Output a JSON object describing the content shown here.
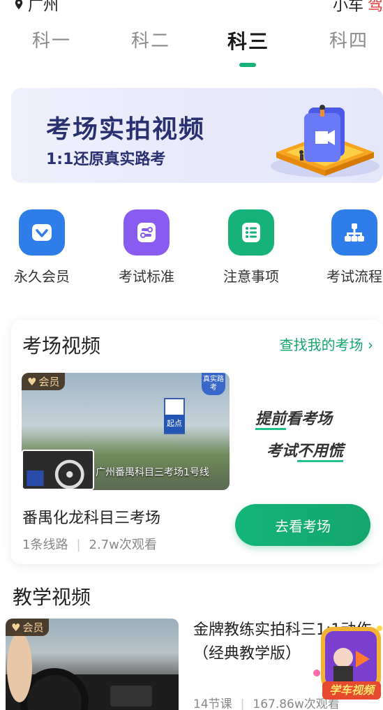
{
  "top": {
    "location": "广州",
    "right_text": "小车",
    "right_red": "驾"
  },
  "tabs": [
    {
      "label": "科一",
      "active": false
    },
    {
      "label": "科二",
      "active": false
    },
    {
      "label": "科三",
      "active": true
    },
    {
      "label": "科四",
      "active": false
    }
  ],
  "banner": {
    "title": "考场实拍视频",
    "subtitle": "1:1还原真实路考"
  },
  "quick_actions": [
    {
      "label": "永久会员",
      "icon": "diamond-icon",
      "color": "#2f7de8"
    },
    {
      "label": "考试标准",
      "icon": "list-toggle-icon",
      "color": "#8a5bf0"
    },
    {
      "label": "注意事项",
      "icon": "checklist-icon",
      "color": "#16b27a"
    },
    {
      "label": "考试流程",
      "icon": "flowchart-icon",
      "color": "#2f7de8"
    }
  ],
  "exam_video": {
    "title": "考场视频",
    "link": "查找我的考场",
    "vip_badge": "会员",
    "real_tag": "真实路考",
    "route_caption": "广州番禺科目三考场1号线",
    "sign_text": "起点",
    "slogan_1": "提前看考场",
    "slogan_2": "考试不用慌",
    "place_name": "番禺化龙科目三考场",
    "routes": "1条线路",
    "views": "2.7w次观看",
    "button": "去看考场"
  },
  "teaching": {
    "title": "教学视频",
    "vip_badge": "会员",
    "lesson_title": "金牌教练实拍科三1:1动作（经典教学版）",
    "lessons": "14节课",
    "views": "167.86w次观看",
    "promo_label": "学车视频"
  }
}
